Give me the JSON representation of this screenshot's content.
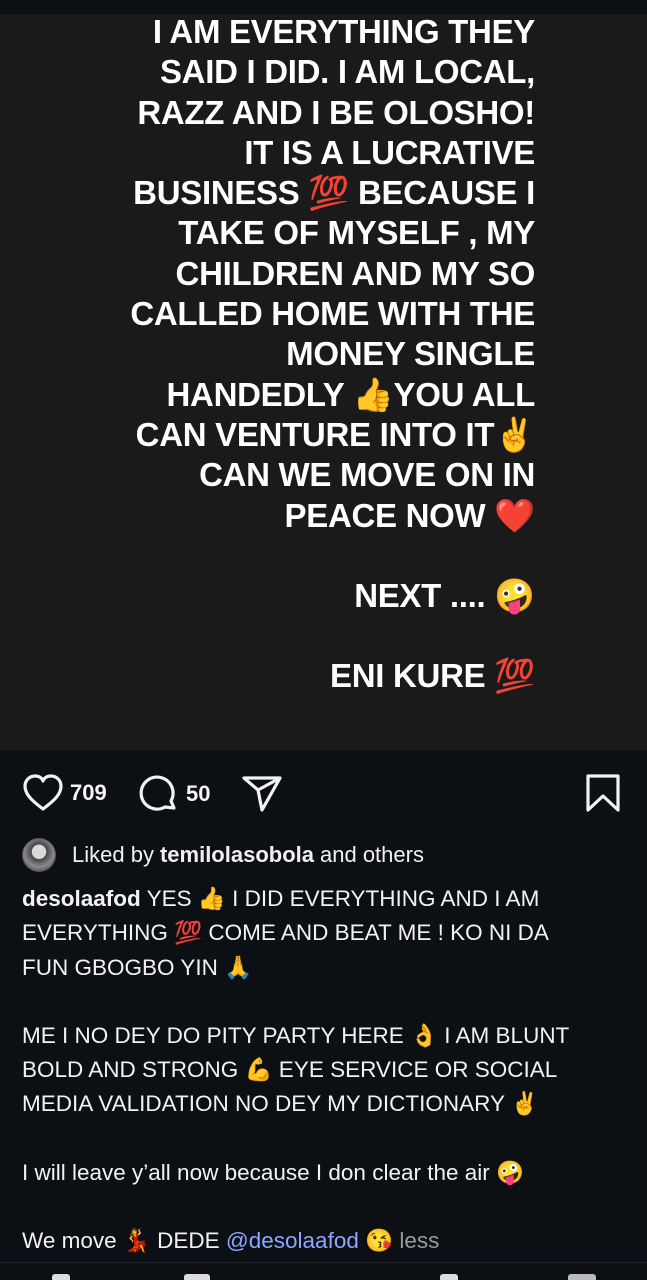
{
  "story": {
    "lines": [
      "I AM EVERYTHING THEY",
      "SAID I DID. I AM LOCAL,",
      "RAZZ AND I BE OLOSHO!",
      "IT IS A LUCRATIVE",
      "BUSINESS 💯 BECAUSE I",
      "TAKE OF MYSELF , MY",
      "CHILDREN AND MY SO",
      "CALLED HOME WITH THE",
      "MONEY  SINGLE",
      "HANDEDLY 👍YOU ALL",
      "CAN VENTURE INTO IT✌️",
      "CAN WE MOVE ON IN",
      "PEACE NOW ❤️"
    ],
    "next": "NEXT .... 🤪",
    "eni": "ENI KURE 💯"
  },
  "actions": {
    "likes": "709",
    "comments": "50",
    "icons": [
      "heart-icon",
      "comment-icon",
      "share-icon",
      "bookmark-icon"
    ]
  },
  "liked_by": {
    "prefix": "Liked by",
    "user": "temilolasobola",
    "suffix": "and others"
  },
  "caption": {
    "username": "desolaafod",
    "line1_rest": " YES 👍 I DID EVERYTHING AND I AM",
    "line2": "EVERYTHING 💯 COME AND BEAT ME !  KO NI DA",
    "line3": "FUN GBOGBO YIN 🙏",
    "line4": "ME I NO DEY DO PITY PARTY HERE 👌 I AM BLUNT",
    "line5": "BOLD AND STRONG 💪 EYE SERVICE OR SOCIAL",
    "line6": "MEDIA VALIDATION NO DEY MY DICTIONARY ✌️",
    "line7": "I will leave y’all now because I don clear the air 🤪",
    "line8_start": "We move 💃 DEDE  ",
    "mention": "@desolaafod",
    "line8_emoji": " 😘 ",
    "less": "less"
  }
}
